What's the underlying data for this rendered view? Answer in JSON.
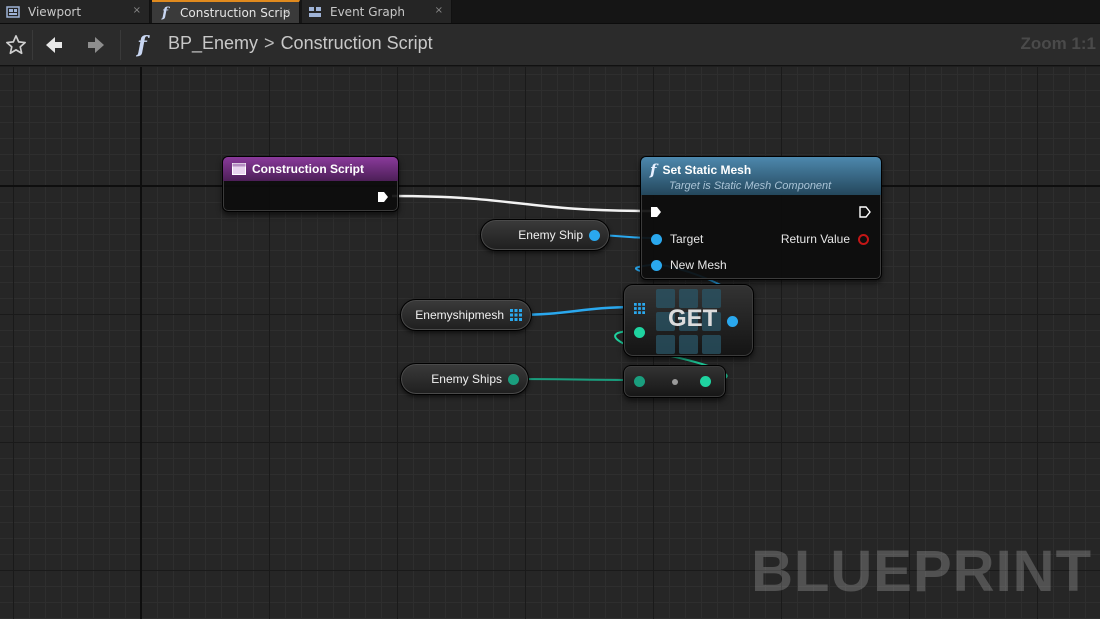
{
  "tabs": [
    {
      "label": "Viewport",
      "icon": "viewport-icon",
      "active": false
    },
    {
      "label": "Construction Scrip",
      "icon": "function-icon",
      "active": true
    },
    {
      "label": "Event Graph",
      "icon": "event-graph-icon",
      "active": false
    }
  ],
  "tab_close_glyph": "×",
  "toolbar": {
    "function_glyph": "f",
    "breadcrumb": [
      "BP_Enemy",
      "Construction Script"
    ],
    "breadcrumb_separator": ">",
    "zoom": "Zoom 1:1"
  },
  "nodes": {
    "construction_script": {
      "title": "Construction Script"
    },
    "set_static_mesh": {
      "title": "Set Static Mesh",
      "subtitle": "Target is Static Mesh Component",
      "pins": {
        "target": "Target",
        "new_mesh": "New Mesh",
        "return_value": "Return Value"
      }
    },
    "get": {
      "label": "GET"
    }
  },
  "variables": {
    "enemy_ship": "Enemy Ship",
    "enemyshipmesh": "Enemyshipmesh",
    "enemy_ships": "Enemy Ships"
  },
  "watermark": "BLUEPRINT",
  "colors": {
    "accent_tab": "#e08a1e",
    "construction_header": "#6b2a7a",
    "function_header": "#3b6e8e",
    "object_pin": "#2aa8ee",
    "integer_pin": "#1fd3a0",
    "return_pin": "#c21616"
  }
}
